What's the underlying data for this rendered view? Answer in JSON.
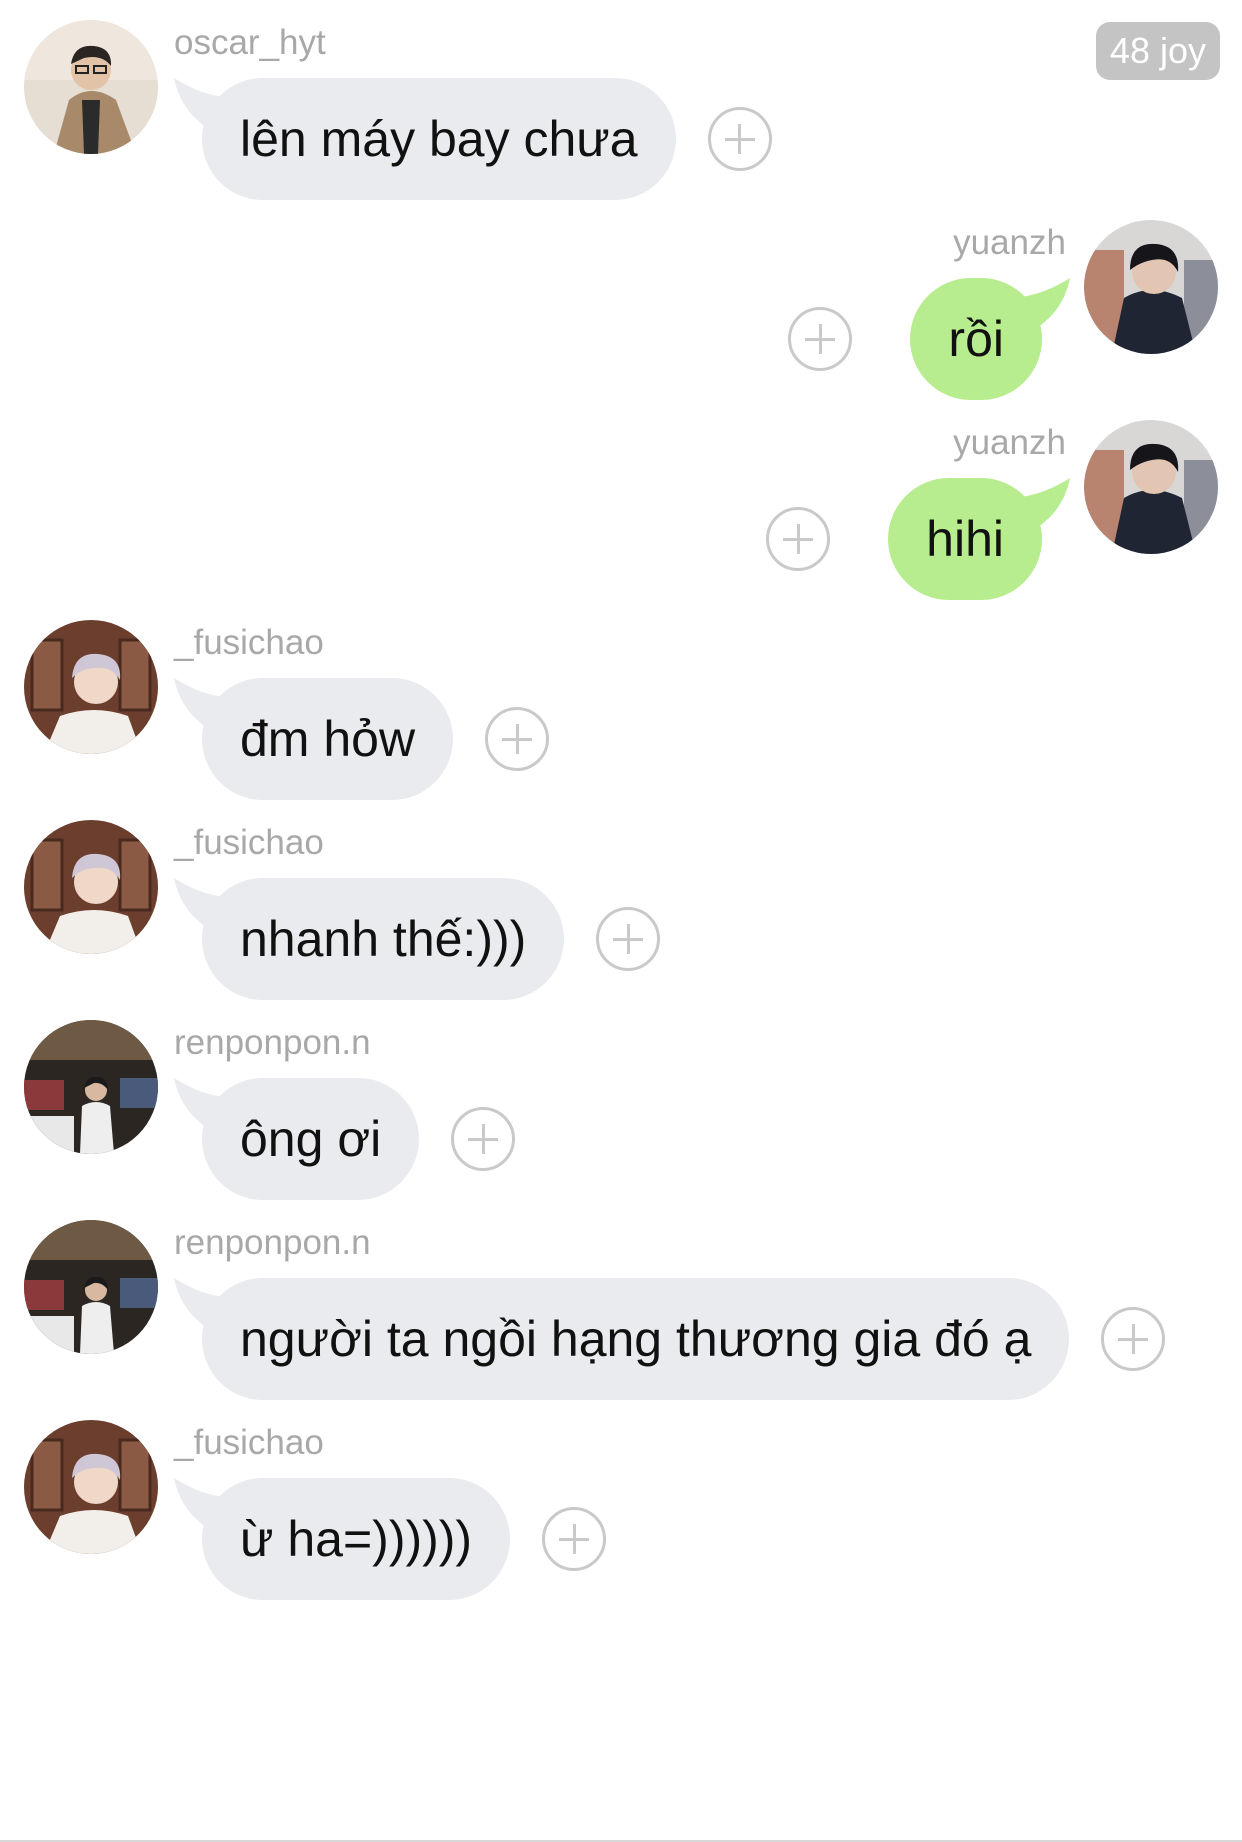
{
  "badge": {
    "text": "48 joy"
  },
  "messages": [
    {
      "user": "oscar_hyt",
      "text": "lên máy bay chưa",
      "side": "in",
      "avatar": "avatar-oscar"
    },
    {
      "user": "yuanzh",
      "text": "rồi",
      "side": "out",
      "avatar": "avatar-yuanzh"
    },
    {
      "user": "yuanzh",
      "text": "hihi",
      "side": "out",
      "avatar": "avatar-yuanzh"
    },
    {
      "user": "_fusichao",
      "text": "đm hỏw",
      "side": "in",
      "avatar": "avatar-fusichao"
    },
    {
      "user": "_fusichao",
      "text": "nhanh thế:)))",
      "side": "in",
      "avatar": "avatar-fusichao"
    },
    {
      "user": "renponpon.n",
      "text": "ông ơi",
      "side": "in",
      "avatar": "avatar-renponpon"
    },
    {
      "user": "renponpon.n",
      "text": "người ta ngồi hạng thương gia đó ạ",
      "side": "in",
      "avatar": "avatar-renponpon"
    },
    {
      "user": "_fusichao",
      "text": "ừ ha=))))))",
      "side": "in",
      "avatar": "avatar-fusichao"
    }
  ],
  "icons": {
    "add": "plus-circle-icon"
  },
  "colors": {
    "incoming_bubble": "#e9ebee",
    "outgoing_bubble": "#b7ed8e",
    "username": "#a8a8a8",
    "badge_bg": "#c4c4c4",
    "add_icon": "#c9c9c9"
  }
}
